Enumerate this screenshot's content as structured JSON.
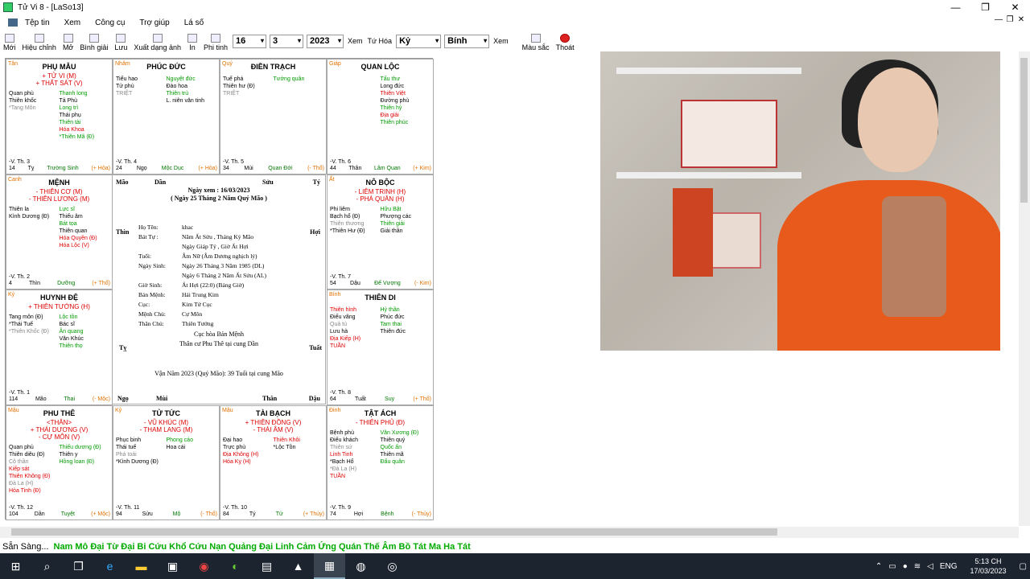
{
  "window": {
    "title": "Tử Vi 8 - [LaSo13]",
    "minimize": "—",
    "restore": "❐",
    "close": "✕"
  },
  "menu": {
    "items": [
      "Tệp tin",
      "Xem",
      "Công cụ",
      "Trợ giúp",
      "Lá số"
    ],
    "mdi": [
      "—",
      "❐",
      "✕"
    ]
  },
  "toolbar": {
    "buttons": [
      "Mới",
      "Hiệu chỉnh",
      "Mở",
      "Bình giải",
      "Lưu",
      "Xuất dạng ảnh",
      "In",
      "Phi tinh"
    ],
    "day": "16",
    "month": "3",
    "year": "2023",
    "view_label": "Xem",
    "tuhoa_label": "Tứ Hóa",
    "tuhoa_value": "Kỷ",
    "can_value": "Bính",
    "view2_label": "Xem",
    "color_label": "Màu sắc",
    "exit_label": "Thoát"
  },
  "palaces": [
    {
      "can": "Tân",
      "name": "PHỤ MẪU",
      "mains": [
        "+ TỬ VI (M)",
        "+ THẤT SÁT (V)"
      ],
      "left": [
        "Quan phù",
        "Thiên khốc",
        "*Tang Môn"
      ],
      "right": [
        "Thanh long",
        "Tả Phù",
        "Long trì",
        "Thái phụ",
        "Thiên tài",
        "Hóa Khoa",
        "*Thiên Mã (Đ)"
      ],
      "v": "-V. Th. 3",
      "num": "14",
      "chi": "Tỵ",
      "life": "Trường Sinh",
      "el": "(+ Hỏa)"
    },
    {
      "can": "Nhâm",
      "name": "PHÚC ĐỨC",
      "mains": [],
      "left": [
        "Tiểu hao",
        "Tử phù",
        "TRIỆT"
      ],
      "right": [
        "Nguyệt đức",
        "Đào hoa",
        "Thiên trù",
        "L. niên văn tinh"
      ],
      "v": "-V. Th. 4",
      "num": "24",
      "chi": "Ngọ",
      "life": "Mộc Dục",
      "el": "(+ Hỏa)"
    },
    {
      "can": "Quý",
      "name": "ĐIỀN TRẠCH",
      "mains": [],
      "left": [
        "Tuế phá",
        "Thiên hư (Đ)",
        "TRIỆT"
      ],
      "right": [
        "Tướng quân"
      ],
      "v": "-V. Th. 5",
      "num": "34",
      "chi": "Mùi",
      "life": "Quan Đới",
      "el": "(- Thổ)"
    },
    {
      "can": "Giáp",
      "name": "QUAN LỘC",
      "mains": [],
      "left": [],
      "right": [
        "Tấu thư",
        "Long đức",
        "Thiên Việt",
        "Đường phù",
        "Thiên hỷ",
        "Địa giải",
        "Thiên phúc"
      ],
      "v": "-V. Th. 6",
      "num": "44",
      "chi": "Thân",
      "life": "Lâm Quan",
      "el": "(+ Kim)"
    },
    {
      "can": "Canh",
      "name": "MỆNH",
      "mains": [
        "- THIÊN CƠ (M)",
        "- THIÊN LƯƠNG (M)"
      ],
      "left": [
        "Thiên la",
        "Kình Dương (Đ)"
      ],
      "right": [
        "Lực sĩ",
        "Thiếu âm",
        "Bát tọa",
        "Thiên quan",
        "Hóa Quyền (Đ)",
        "Hóa Lộc (V)"
      ],
      "v": "-V. Th. 2",
      "num": "4",
      "chi": "Thìn",
      "life": "Dưỡng",
      "el": "(+ Thổ)"
    },
    {
      "can": "Ất",
      "name": "NÔ BỘC",
      "mains": [
        "- LIÊM TRINH (H)",
        "- PHÁ QUÂN (H)"
      ],
      "left": [
        "Phi liêm",
        "Bạch hổ (Đ)",
        "Thiên thương",
        "*Thiên Hư (Đ)"
      ],
      "right": [
        "Hữu Bật",
        "Phượng các",
        "Thiên giải",
        "Giải thần"
      ],
      "v": "-V. Th. 7",
      "num": "54",
      "chi": "Dậu",
      "life": "Đế Vượng",
      "el": "(- Kim)"
    },
    {
      "can": "Kỷ",
      "name": "HUYNH ĐỆ",
      "mains": [
        "+ THIÊN TƯỚNG (H)"
      ],
      "left": [
        "Tang môn (Đ)",
        "*Thái Tuế",
        "*Thiên Khốc (Đ)"
      ],
      "right": [
        "Lộc tồn",
        "Bác sĩ",
        "Ân quang",
        "Văn Khúc",
        "Thiên thọ"
      ],
      "v": "-V. Th. 1",
      "num": "114",
      "chi": "Mão",
      "life": "Thai",
      "el": "(- Mộc)"
    },
    {
      "can": "Bính",
      "name": "THIÊN DI",
      "mains": [],
      "left": [
        "Thiên hình",
        "Điếu vãng",
        "Quả tú",
        "Lưu hà",
        "Địa Kiếp (H)",
        "TUẦN"
      ],
      "right": [
        "Hỷ thần",
        "Phúc đức",
        "Tam thai",
        "Thiên đức"
      ],
      "v": "-V. Th. 8",
      "num": "64",
      "chi": "Tuất",
      "life": "Suy",
      "el": "(+ Thổ)"
    },
    {
      "can": "Mậu",
      "name": "PHU THÊ",
      "mains": [
        "<THÂN>",
        "+ THÁI DƯƠNG (V)",
        "- CỰ MÔN (V)"
      ],
      "left": [
        "Quan phủ",
        "Thiên diêu (Đ)",
        "Cô thần",
        "Kiếp sát",
        "Thiên Không (Đ)",
        "Đà La (H)",
        "Hỏa Tinh (Đ)"
      ],
      "right": [
        "Thiếu dương (Đ)",
        "Thiên y",
        "Hồng loan (Đ)"
      ],
      "v": "-V. Th. 12",
      "num": "104",
      "chi": "Dần",
      "life": "Tuyệt",
      "el": "(+ Mộc)"
    },
    {
      "can": "Kỷ",
      "name": "TỬ TỨC",
      "mains": [
        "- VŨ KHÚC (M)",
        "- THAM LANG (M)"
      ],
      "left": [
        "Phục binh",
        "Thái tuế",
        "Phá toái",
        "*Kình Dương (Đ)"
      ],
      "right": [
        "Phong cáo",
        "Hoa cái"
      ],
      "v": "-V. Th. 11",
      "num": "94",
      "chi": "Sửu",
      "life": "Mộ",
      "el": "(- Thổ)"
    },
    {
      "can": "Mậu",
      "name": "TÀI BẠCH",
      "mains": [
        "+ THIÊN ĐỒNG (V)",
        "- THÁI ÂM (V)"
      ],
      "left": [
        "Đại hao",
        "Trực phù",
        "Địa Không (H)",
        "Hóa Kỵ (H)"
      ],
      "right": [
        "Thiên Khôi",
        "*Lộc Tồn"
      ],
      "v": "-V. Th. 10",
      "num": "84",
      "chi": "Tý",
      "life": "Tử",
      "el": "(+ Thủy)"
    },
    {
      "can": "Đinh",
      "name": "TẬT ÁCH",
      "mains": [
        "- THIÊN PHỦ (Đ)"
      ],
      "left": [
        "Bệnh phù",
        "Điếu khách",
        "Thiên sứ",
        "Linh Tinh",
        "*Bạch Hổ",
        "*Đà La (H)",
        "TUẦN"
      ],
      "right": [
        "Văn Xương (Đ)",
        "Thiên quý",
        "Quốc ấn",
        "Thiên mã",
        "Đẩu quân"
      ],
      "v": "-V. Th. 9",
      "num": "74",
      "chi": "Hợi",
      "life": "Bệnh",
      "el": "(- Thủy)"
    }
  ],
  "center": {
    "corners": {
      "tl1": "Mão",
      "tl2": "Dần",
      "tr1": "Sửu",
      "tr2": "Tý",
      "ml": "Thìn",
      "mr": "Hợi",
      "bl": "Tỵ",
      "br": "Tuất",
      "b1": "Ngọ",
      "b2": "Mùi",
      "b3": "Thân",
      "b4": "Dậu"
    },
    "date1": "Ngày xem : 16/03/2023",
    "date2": "( Ngày 25 Tháng 2 Năm Quý Mão )",
    "rows": [
      [
        "Họ Tên:",
        "khac"
      ],
      [
        "Bát Tự :",
        "Năm Ất Sửu , Tháng Kỷ Mão"
      ],
      [
        "",
        "Ngày Giáp Tý , Giờ Ất Hợi"
      ],
      [
        "Tuổi:",
        "Âm Nữ (Âm Dương nghịch lý)"
      ],
      [
        "Ngày Sinh:",
        "Ngày 26 Tháng 3 Năm 1985 (DL)"
      ],
      [
        "",
        "Ngày 6 Tháng 2 Năm Ất Sửu (AL)"
      ],
      [
        "Giờ Sinh:",
        "Ất Hợi (22:0) (Bảng Giờ)"
      ],
      [
        "Bản Mệnh:",
        "Hải Trung Kim"
      ],
      [
        "Cục:",
        "Kim Tứ Cục"
      ],
      [
        "Mệnh Chủ:",
        "Cự Môn"
      ],
      [
        "Thân Chủ:",
        "Thiên Tướng"
      ]
    ],
    "cuc": "Cục hòa Bản Mệnh",
    "than": "Thân cư Phu Thê tại cung Dần",
    "han": "Vận Năm 2023 (Quý Mão): 39 Tuổi tại cung Mão"
  },
  "status": {
    "ready": "Sẵn Sàng...",
    "message": "Nam Mô Đại Từ Đại Bi Cứu Khổ Cứu Nạn Quảng Đại Linh Cảm Ứng Quán Thế Âm Bồ Tát Ma Ha Tát"
  },
  "taskbar": {
    "time": "5:13 CH",
    "date": "17/03/2023",
    "lang": "ENG",
    "icons": [
      "windows-start-icon",
      "search-icon",
      "task-view-icon",
      "edge-icon",
      "folder-icon",
      "store-icon",
      "chrome-icon",
      "green-app-icon",
      "app-icon",
      "photos-icon",
      "tuvi-app-icon",
      "messenger-icon",
      "obs-icon"
    ]
  }
}
